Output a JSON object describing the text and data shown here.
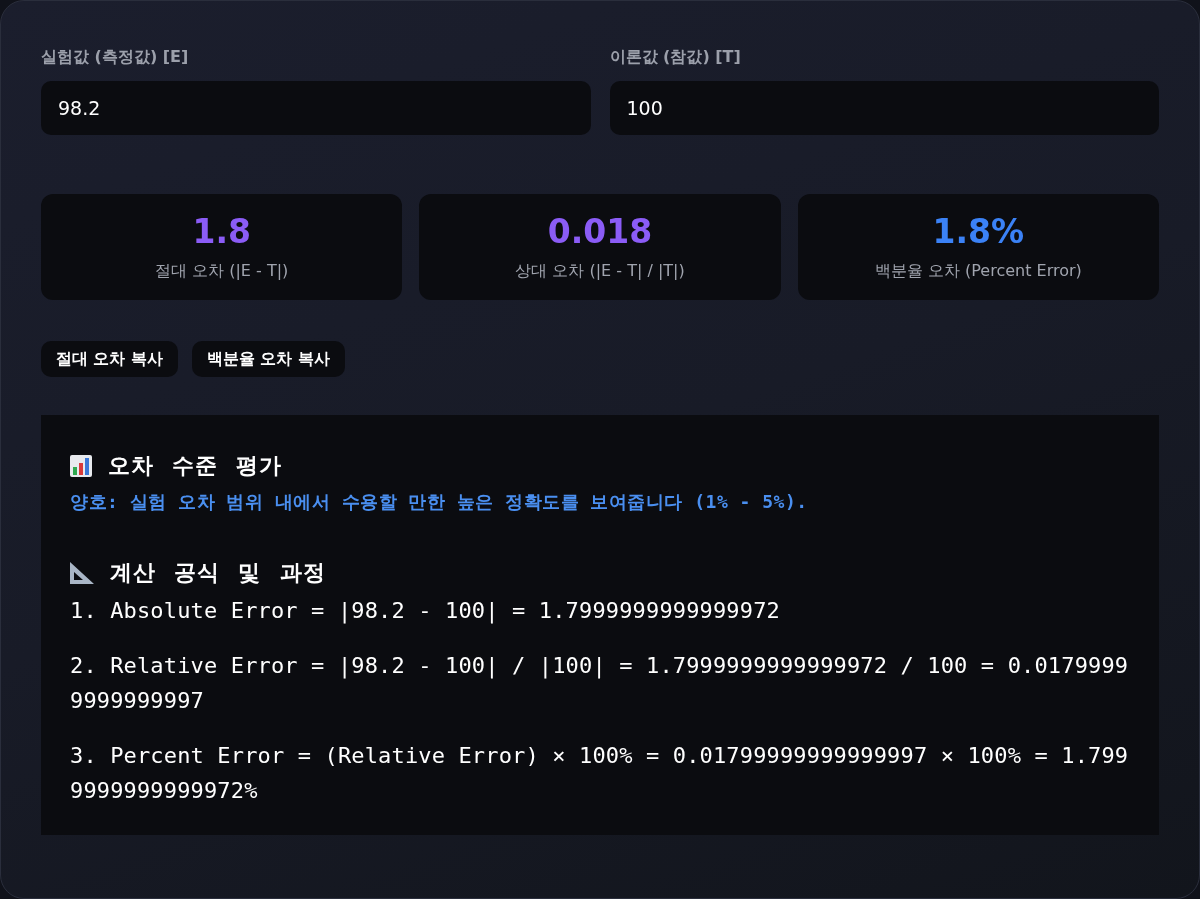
{
  "inputs": [
    {
      "label": "실험값 (측정값) [E]",
      "value": "98.2"
    },
    {
      "label": "이론값 (참값) [T]",
      "value": "100"
    }
  ],
  "results": [
    {
      "value": "1.8",
      "label": "절대 오차 (|E - T|)",
      "color": "#8b5cf6"
    },
    {
      "value": "0.018",
      "label": "상대 오차 (|E - T| / |T|)",
      "color": "#8b5cf6"
    },
    {
      "value": "1.8%",
      "label": "백분율 오차 (Percent Error)",
      "color": "#3b82f6"
    }
  ],
  "buttons": [
    "절대 오차 복사",
    "백분율 오차 복사"
  ],
  "evaluation": {
    "title": "오차 수준 평가",
    "message": "양호: 실험 오차 범위 내에서 수용할 만한 높은 정확도를 보여줍니다 (1% - 5%)."
  },
  "formula": {
    "title": "계산 공식 및 과정",
    "steps": [
      "1. Absolute Error = |98.2 - 100| = 1.7999999999999972",
      "2. Relative Error = |98.2 - 100| / |100| = 1.7999999999999972 / 100 = 0.01799999999999997",
      "3. Percent Error = (Relative Error) × 100% = 0.01799999999999997 × 100% = 1.7999999999999972%"
    ]
  }
}
